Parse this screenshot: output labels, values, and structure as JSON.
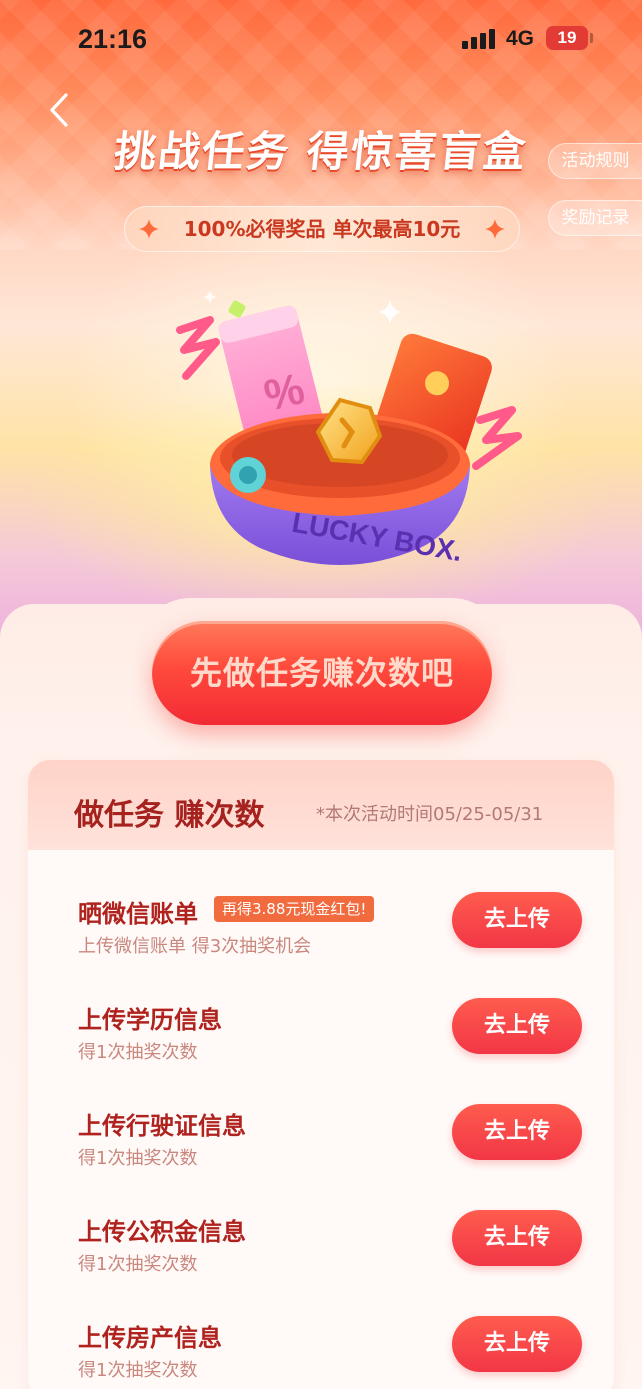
{
  "status_bar": {
    "time": "21:16",
    "network": "4G",
    "battery": "19"
  },
  "header": {
    "title": "挑战任务 得惊喜盲盒",
    "rules_label": "活动规则",
    "records_label": "奖励记录",
    "promo_text": "100%必得奖品 单次最高10元"
  },
  "hero": {
    "box_text": "LUCKY BOX."
  },
  "cta": {
    "label": "先做任务赚次数吧"
  },
  "tasks": {
    "title": "做任务 赚次数",
    "note": "*本次活动时间05/25-05/31",
    "items": [
      {
        "name": "晒微信账单",
        "badge": "再得3.88元现金红包!",
        "desc": "上传微信账单 得3次抽奖机会",
        "button": "去上传"
      },
      {
        "name": "上传学历信息",
        "desc": "得1次抽奖次数",
        "button": "去上传"
      },
      {
        "name": "上传行驶证信息",
        "desc": "得1次抽奖次数",
        "button": "去上传"
      },
      {
        "name": "上传公积金信息",
        "desc": "得1次抽奖次数",
        "button": "去上传"
      },
      {
        "name": "上传房产信息",
        "desc": "得1次抽奖次数",
        "button": "去上传"
      }
    ]
  },
  "colors": {
    "accent_red": "#f23646",
    "title_red": "#a5221f",
    "badge_orange": "#f26b3f",
    "battery_red": "#e23b36"
  },
  "icons": [
    "back-icon",
    "sparkle-icon",
    "signal-icon",
    "battery-icon"
  ]
}
